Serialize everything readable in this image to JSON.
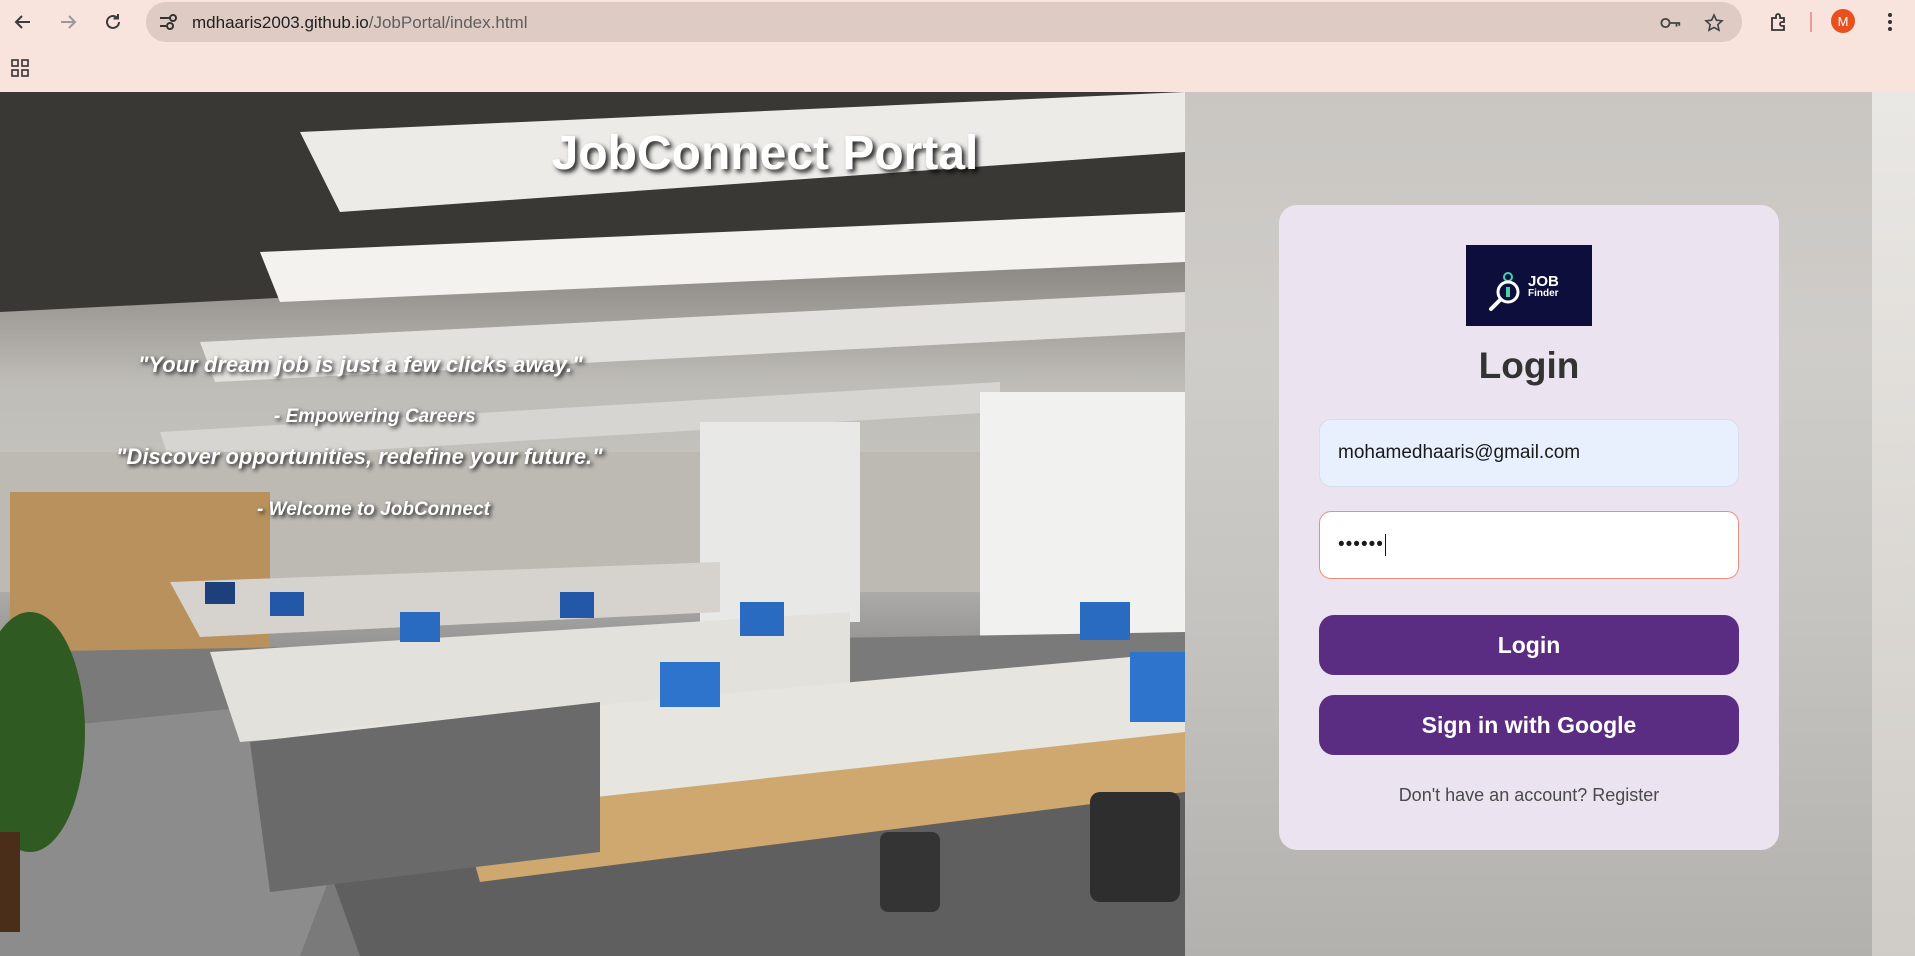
{
  "browser": {
    "url_host": "mdhaaris2003.github.io",
    "url_path": "/JobPortal/index.html",
    "profile_initial": "M"
  },
  "hero": {
    "title": "JobConnect Portal",
    "quotes": [
      {
        "text": "\"Your dream job is just a few clicks away.\"",
        "author": "- Empowering Careers"
      },
      {
        "text": "\"Discover opportunities, redefine your future.\"",
        "author": "- Welcome to JobConnect"
      }
    ]
  },
  "login": {
    "logo": {
      "line1": "JOB",
      "line2": "Finder"
    },
    "title": "Login",
    "email_value": "mohamedhaaris@gmail.com",
    "password_value": "••••••",
    "login_button": "Login",
    "google_button": "Sign in with Google",
    "register_text": "Don't have an account? Register"
  },
  "colors": {
    "button": "#5a2d82",
    "card": "#ebe3ef",
    "chrome": "#f8e3dd"
  }
}
